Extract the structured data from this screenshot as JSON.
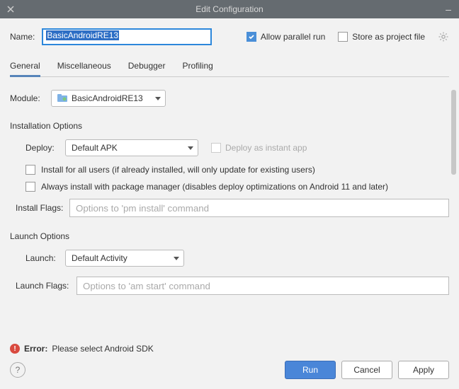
{
  "window": {
    "title": "Edit Configuration"
  },
  "name": {
    "label": "Name:",
    "value": "BasicAndroidRE13"
  },
  "options": {
    "allow_parallel": {
      "label": "Allow parallel run",
      "checked": true
    },
    "store_project": {
      "label": "Store as project file",
      "checked": false
    }
  },
  "tabs": {
    "items": [
      {
        "label": "General",
        "active": true
      },
      {
        "label": "Miscellaneous",
        "active": false
      },
      {
        "label": "Debugger",
        "active": false
      },
      {
        "label": "Profiling",
        "active": false
      }
    ]
  },
  "module": {
    "label": "Module:",
    "value": "BasicAndroidRE13"
  },
  "install": {
    "title": "Installation Options",
    "deploy": {
      "label": "Deploy:",
      "value": "Default APK"
    },
    "instant": {
      "label": "Deploy as instant app",
      "checked": false
    },
    "all_users": {
      "label": "Install for all users (if already installed, will only update for existing users)",
      "checked": false
    },
    "always_pm": {
      "label": "Always install with package manager (disables deploy optimizations on Android 11 and later)",
      "checked": false
    },
    "flags": {
      "label": "Install Flags:",
      "placeholder": "Options to 'pm install' command"
    }
  },
  "launch": {
    "title": "Launch Options",
    "launch": {
      "label": "Launch:",
      "value": "Default Activity"
    },
    "flags": {
      "label": "Launch Flags:",
      "placeholder": "Options to 'am start' command"
    }
  },
  "error": {
    "prefix": "Error:",
    "message": "Please select Android SDK"
  },
  "buttons": {
    "run": "Run",
    "cancel": "Cancel",
    "apply": "Apply"
  }
}
